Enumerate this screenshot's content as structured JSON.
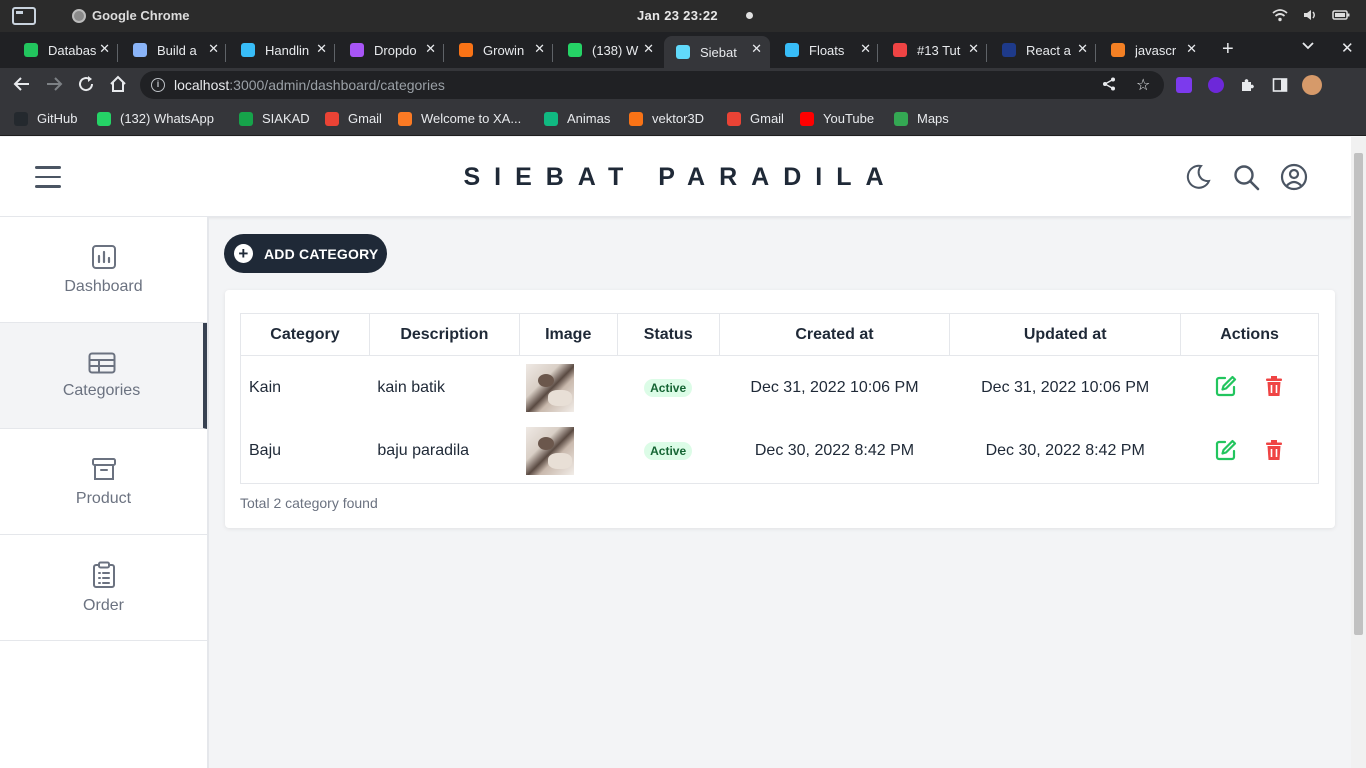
{
  "os": {
    "app_name": "Google Chrome",
    "clock": "Jan 23  23:22"
  },
  "tabs": [
    {
      "title": "Databas",
      "color": "#22c55e"
    },
    {
      "title": "Build a",
      "color": "#8ab4f8"
    },
    {
      "title": "Handlin",
      "color": "#38bdf8"
    },
    {
      "title": "Dropdo",
      "color": "#a855f7"
    },
    {
      "title": "Growin",
      "color": "#f97316"
    },
    {
      "title": "(138) W",
      "color": "#25d366"
    },
    {
      "title": "Siebat",
      "color": "#61dafb",
      "active": true
    },
    {
      "title": "Floats",
      "color": "#38bdf8"
    },
    {
      "title": "#13 Tut",
      "color": "#ef4444"
    },
    {
      "title": "React a",
      "color": "#1e3a8a"
    },
    {
      "title": "javascr",
      "color": "#f48024"
    }
  ],
  "address": {
    "host": "localhost",
    "path": ":3000/admin/dashboard/categories"
  },
  "bookmarks": [
    {
      "label": "GitHub",
      "color": "#24292e"
    },
    {
      "label": "(132) WhatsApp",
      "color": "#25d366"
    },
    {
      "label": "SIAKAD",
      "color": "#16a34a"
    },
    {
      "label": "Gmail",
      "color": "#ea4335"
    },
    {
      "label": "Welcome to XA...",
      "color": "#fb7a24"
    },
    {
      "label": "Animas",
      "color": "#10b981"
    },
    {
      "label": "vektor3D",
      "color": "#f97316"
    },
    {
      "label": "Gmail",
      "color": "#ea4335"
    },
    {
      "label": "YouTube",
      "color": "#ff0000"
    },
    {
      "label": "Maps",
      "color": "#34a853"
    }
  ],
  "header": {
    "brand": "SIEBAT PARADILA"
  },
  "sidebar": {
    "items": [
      {
        "label": "Dashboard",
        "icon": "chart-bar-icon"
      },
      {
        "label": "Categories",
        "icon": "table-icon",
        "active": true
      },
      {
        "label": "Product",
        "icon": "archive-box-icon"
      },
      {
        "label": "Order",
        "icon": "clipboard-list-icon"
      }
    ]
  },
  "main": {
    "add_button": "ADD CATEGORY",
    "table": {
      "columns": [
        "Category",
        "Description",
        "Image",
        "Status",
        "Created at",
        "Updated at",
        "Actions"
      ],
      "rows": [
        {
          "category": "Kain",
          "description": "kain batik",
          "status": "Active",
          "created_at": "Dec 31, 2022 10:06 PM",
          "updated_at": "Dec 31, 2022 10:06 PM"
        },
        {
          "category": "Baju",
          "description": "baju paradila",
          "status": "Active",
          "created_at": "Dec 30, 2022 8:42 PM",
          "updated_at": "Dec 30, 2022 8:42 PM"
        }
      ]
    },
    "total_text": "Total 2 category found"
  },
  "colors": {
    "edit": "#22c55e",
    "delete": "#ef4444",
    "active_badge_bg": "#dcfce7",
    "active_badge_text": "#166534",
    "brand_dark": "#1f2937"
  }
}
